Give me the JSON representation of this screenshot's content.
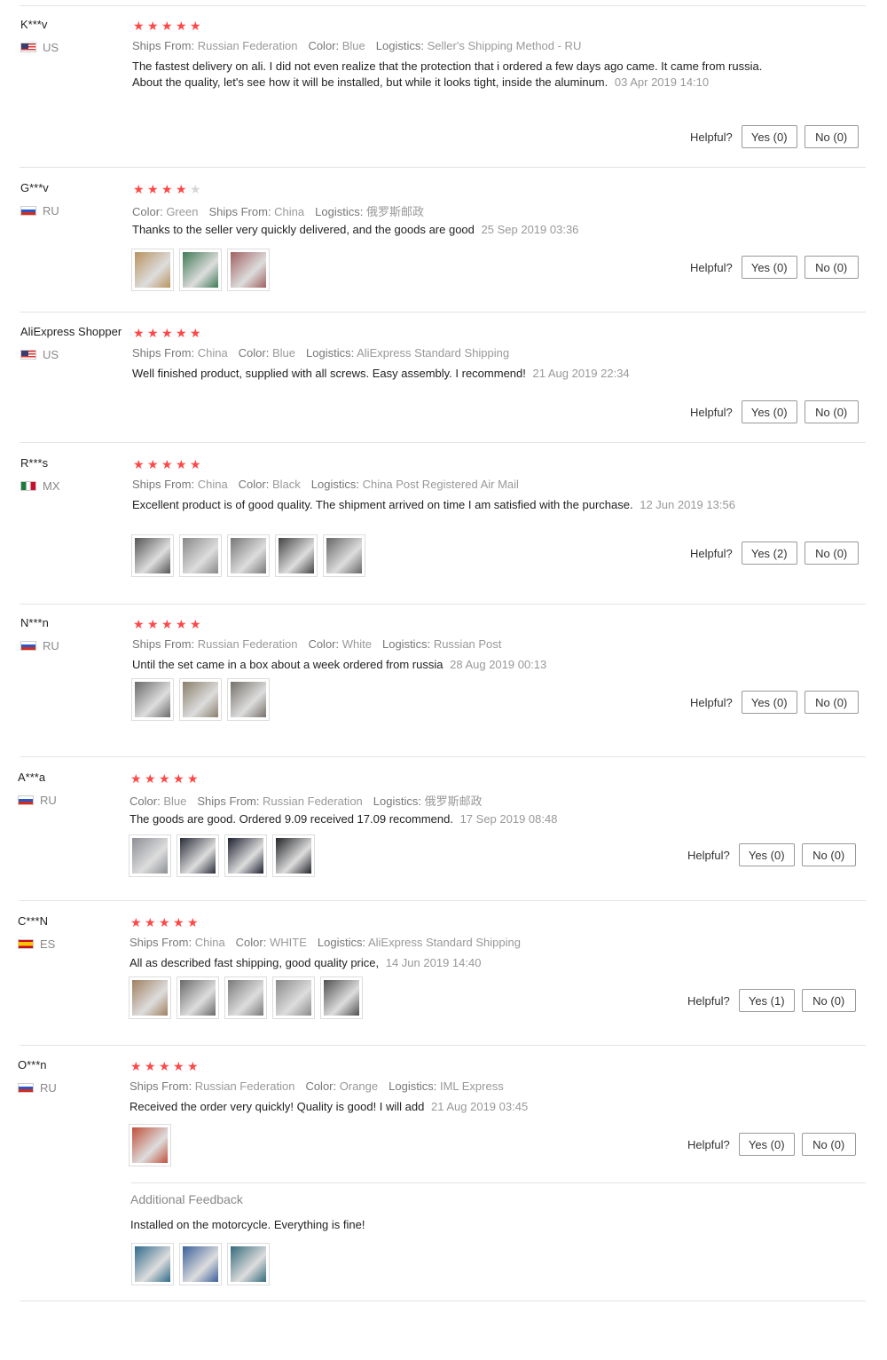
{
  "labels": {
    "helpful": "Helpful?"
  },
  "reviews": [
    {
      "user": "K***v",
      "country": "US",
      "flag": "us",
      "rating": 5,
      "meta": [
        {
          "k": "Ships From:",
          "v": "Russian Federation"
        },
        {
          "k": "Color:",
          "v": "Blue"
        },
        {
          "k": "Logistics:",
          "v": "Seller's Shipping Method - RU"
        }
      ],
      "text": "The fastest delivery on ali. I did not even realize that the protection that i ordered a few days ago came. It came from russia. About the quality, let's see how it will be installed, but while it looks tight, inside the aluminum.",
      "date": "03 Apr 2019 14:10",
      "yes": "Yes (0)",
      "no": "No (0)",
      "thumbs": []
    },
    {
      "user": "G***v",
      "country": "RU",
      "flag": "ru",
      "rating": 4,
      "meta": [
        {
          "k": "Color:",
          "v": "Green"
        },
        {
          "k": "Ships From:",
          "v": "China"
        },
        {
          "k": "Logistics:",
          "v": "俄罗斯邮政"
        }
      ],
      "text": "Thanks to the seller very quickly delivered, and the goods are good",
      "date": "25 Sep 2019 03:36",
      "yes": "Yes (0)",
      "no": "No (0)",
      "thumbs": [
        "#b8935e",
        "#3f7a55",
        "#a06060"
      ]
    },
    {
      "user": "AliExpress Shopper",
      "country": "US",
      "flag": "us",
      "rating": 5,
      "meta": [
        {
          "k": "Ships From:",
          "v": "China"
        },
        {
          "k": "Color:",
          "v": "Blue"
        },
        {
          "k": "Logistics:",
          "v": "AliExpress Standard Shipping"
        }
      ],
      "text": "Well finished product, supplied with all screws. Easy assembly. I recommend!",
      "date": "21 Aug 2019 22:34",
      "yes": "Yes (0)",
      "no": "No (0)",
      "thumbs": []
    },
    {
      "user": "R***s",
      "country": "MX",
      "flag": "mx",
      "rating": 5,
      "meta": [
        {
          "k": "Ships From:",
          "v": "China"
        },
        {
          "k": "Color:",
          "v": "Black"
        },
        {
          "k": "Logistics:",
          "v": "China Post Registered Air Mail"
        }
      ],
      "text": "Excellent product is of good quality. The shipment arrived on time I am satisfied with the purchase.",
      "date": "12 Jun 2019 13:56",
      "yes": "Yes (2)",
      "no": "No (0)",
      "thumbs": [
        "#555555",
        "#888888",
        "#777777",
        "#444444",
        "#666666"
      ]
    },
    {
      "user": "N***n",
      "country": "RU",
      "flag": "ru",
      "rating": 5,
      "meta": [
        {
          "k": "Ships From:",
          "v": "Russian Federation"
        },
        {
          "k": "Color:",
          "v": "White"
        },
        {
          "k": "Logistics:",
          "v": "Russian Post"
        }
      ],
      "text": "Until the set came in a box about a week ordered from russia",
      "date": "28 Aug 2019 00:13",
      "yes": "Yes (0)",
      "no": "No (0)",
      "thumbs": [
        "#6a6a6a",
        "#8a7f6a",
        "#75706a"
      ]
    },
    {
      "user": "A***a",
      "country": "RU",
      "flag": "ru",
      "rating": 5,
      "meta": [
        {
          "k": "Color:",
          "v": "Blue"
        },
        {
          "k": "Ships From:",
          "v": "Russian Federation"
        },
        {
          "k": "Logistics:",
          "v": "俄罗斯邮政"
        }
      ],
      "text": "The goods are good. Ordered 9.09 received 17.09 recommend.",
      "date": "17 Sep 2019 08:48",
      "yes": "Yes (0)",
      "no": "No (0)",
      "thumbs": [
        "#8c8f96",
        "#2a2d3a",
        "#1d2030",
        "#222428"
      ]
    },
    {
      "user": "C***N",
      "country": "ES",
      "flag": "es",
      "rating": 5,
      "meta": [
        {
          "k": "Ships From:",
          "v": "China"
        },
        {
          "k": "Color:",
          "v": "WHITE"
        },
        {
          "k": "Logistics:",
          "v": "AliExpress Standard Shipping"
        }
      ],
      "text": "All as described fast shipping, good quality price,",
      "date": "14 Jun 2019 14:40",
      "yes": "Yes (1)",
      "no": "No (0)",
      "thumbs": [
        "#a08060",
        "#6a6a6a",
        "#7a7a7a",
        "#8a8a8a",
        "#505050"
      ]
    },
    {
      "user": "O***n",
      "country": "RU",
      "flag": "ru",
      "rating": 5,
      "meta": [
        {
          "k": "Ships From:",
          "v": "Russian Federation"
        },
        {
          "k": "Color:",
          "v": "Orange"
        },
        {
          "k": "Logistics:",
          "v": "IML Express"
        }
      ],
      "text": "Received the order very quickly! Quality is good! I will add",
      "date": "21 Aug 2019 03:45",
      "yes": "Yes (0)",
      "no": "No (0)",
      "thumbs": [
        "#c0503a"
      ]
    }
  ],
  "additional": {
    "title": "Additional Feedback",
    "text": "Installed on the motorcycle. Everything is fine!",
    "thumbs": [
      "#2f6a8a",
      "#3a5f9a",
      "#336a7a"
    ]
  }
}
